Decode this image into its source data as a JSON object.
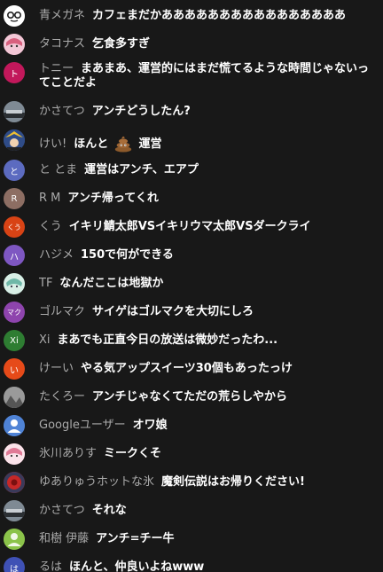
{
  "messages": [
    {
      "author": "青メガネ",
      "text": "カフェまだかああああああああああああああああ",
      "avatar": {
        "icon": "glasses-face-avatar",
        "color": "#ffffff"
      }
    },
    {
      "author": "タコナス",
      "text": "乞食多すぎ",
      "avatar": {
        "icon": "anime-girl-avatar",
        "color": "#e8a0b8"
      }
    },
    {
      "author": "トニー",
      "text": "まあまあ、運営的にはまだ慌てるような時間じゃないってことだよ",
      "avatar": {
        "initial": "ト",
        "color": "#c2185b"
      }
    },
    {
      "author": "かさてつ",
      "text": "アンチどうしたん?",
      "avatar": {
        "icon": "train-photo-avatar",
        "color": "#5a6470"
      }
    },
    {
      "author": "けい!",
      "text_before": "ほんと",
      "text_after": "運営",
      "emoji": "pile-of-poo-emoji",
      "avatar": {
        "icon": "anime-character-avatar",
        "color": "#3a5a9a"
      }
    },
    {
      "author": "と とま",
      "text": "運営はアンチ、エアプ",
      "avatar": {
        "initial": "と",
        "color": "#5c6bc0"
      }
    },
    {
      "author": "R M",
      "text": "アンチ帰ってくれ",
      "avatar": {
        "initial": "R",
        "color": "#8d6e63"
      }
    },
    {
      "author": "くう",
      "text": "イキリ鯖太郎VSイキリウマ太郎VSダークライ",
      "avatar": {
        "initial": "くう",
        "color": "#d84315"
      }
    },
    {
      "author": "ハジメ",
      "text": "150で何ができる",
      "avatar": {
        "initial": "ハ",
        "color": "#7e57c2"
      }
    },
    {
      "author": "TF",
      "text": "なんだここは地獄か",
      "avatar": {
        "icon": "anime-girl-avatar",
        "color": "#a8d8c8"
      }
    },
    {
      "author": "ゴルマク",
      "text": "サイゲはゴルマクを大切にしろ",
      "avatar": {
        "initial": "マク",
        "color": "#8e44ad"
      }
    },
    {
      "author": "Xi",
      "text": "まあでも正直今日の放送は微妙だったわ...",
      "avatar": {
        "initial": "Xi",
        "color": "#2e7d32"
      }
    },
    {
      "author": "けーい",
      "text": "やる気アップスイーツ30個もあったっけ",
      "avatar": {
        "initial": "い",
        "color": "#e64a19"
      }
    },
    {
      "author": "たくろー",
      "text": "アンチじゃなくてただの荒らしやから",
      "avatar": {
        "icon": "gray-photo-avatar",
        "color": "#6d6d6d"
      }
    },
    {
      "author": "Googleユーザー",
      "text": "オワ娘",
      "avatar": {
        "icon": "default-user-avatar",
        "color": "#4a7bd0"
      }
    },
    {
      "author": "氷川ありす",
      "text": "ミークくそ",
      "avatar": {
        "icon": "anime-girl-avatar",
        "color": "#f0b0c0"
      }
    },
    {
      "author": "ゆありゅうホットな氷",
      "text": "魔剣伝説はお帰りください!",
      "avatar": {
        "icon": "red-emblem-avatar",
        "color": "#c62828"
      }
    },
    {
      "author": "かさてつ",
      "text": "それな",
      "avatar": {
        "icon": "train-photo-avatar",
        "color": "#5a6470"
      }
    },
    {
      "author": "和樹 伊藤",
      "text": "アンチ=チー牛",
      "avatar": {
        "icon": "green-person-avatar",
        "color": "#7cb342"
      }
    },
    {
      "author": "るは",
      "text": "ほんと、仲良いよねwww",
      "avatar": {
        "initial": "は",
        "color": "#3f51b5"
      }
    }
  ]
}
